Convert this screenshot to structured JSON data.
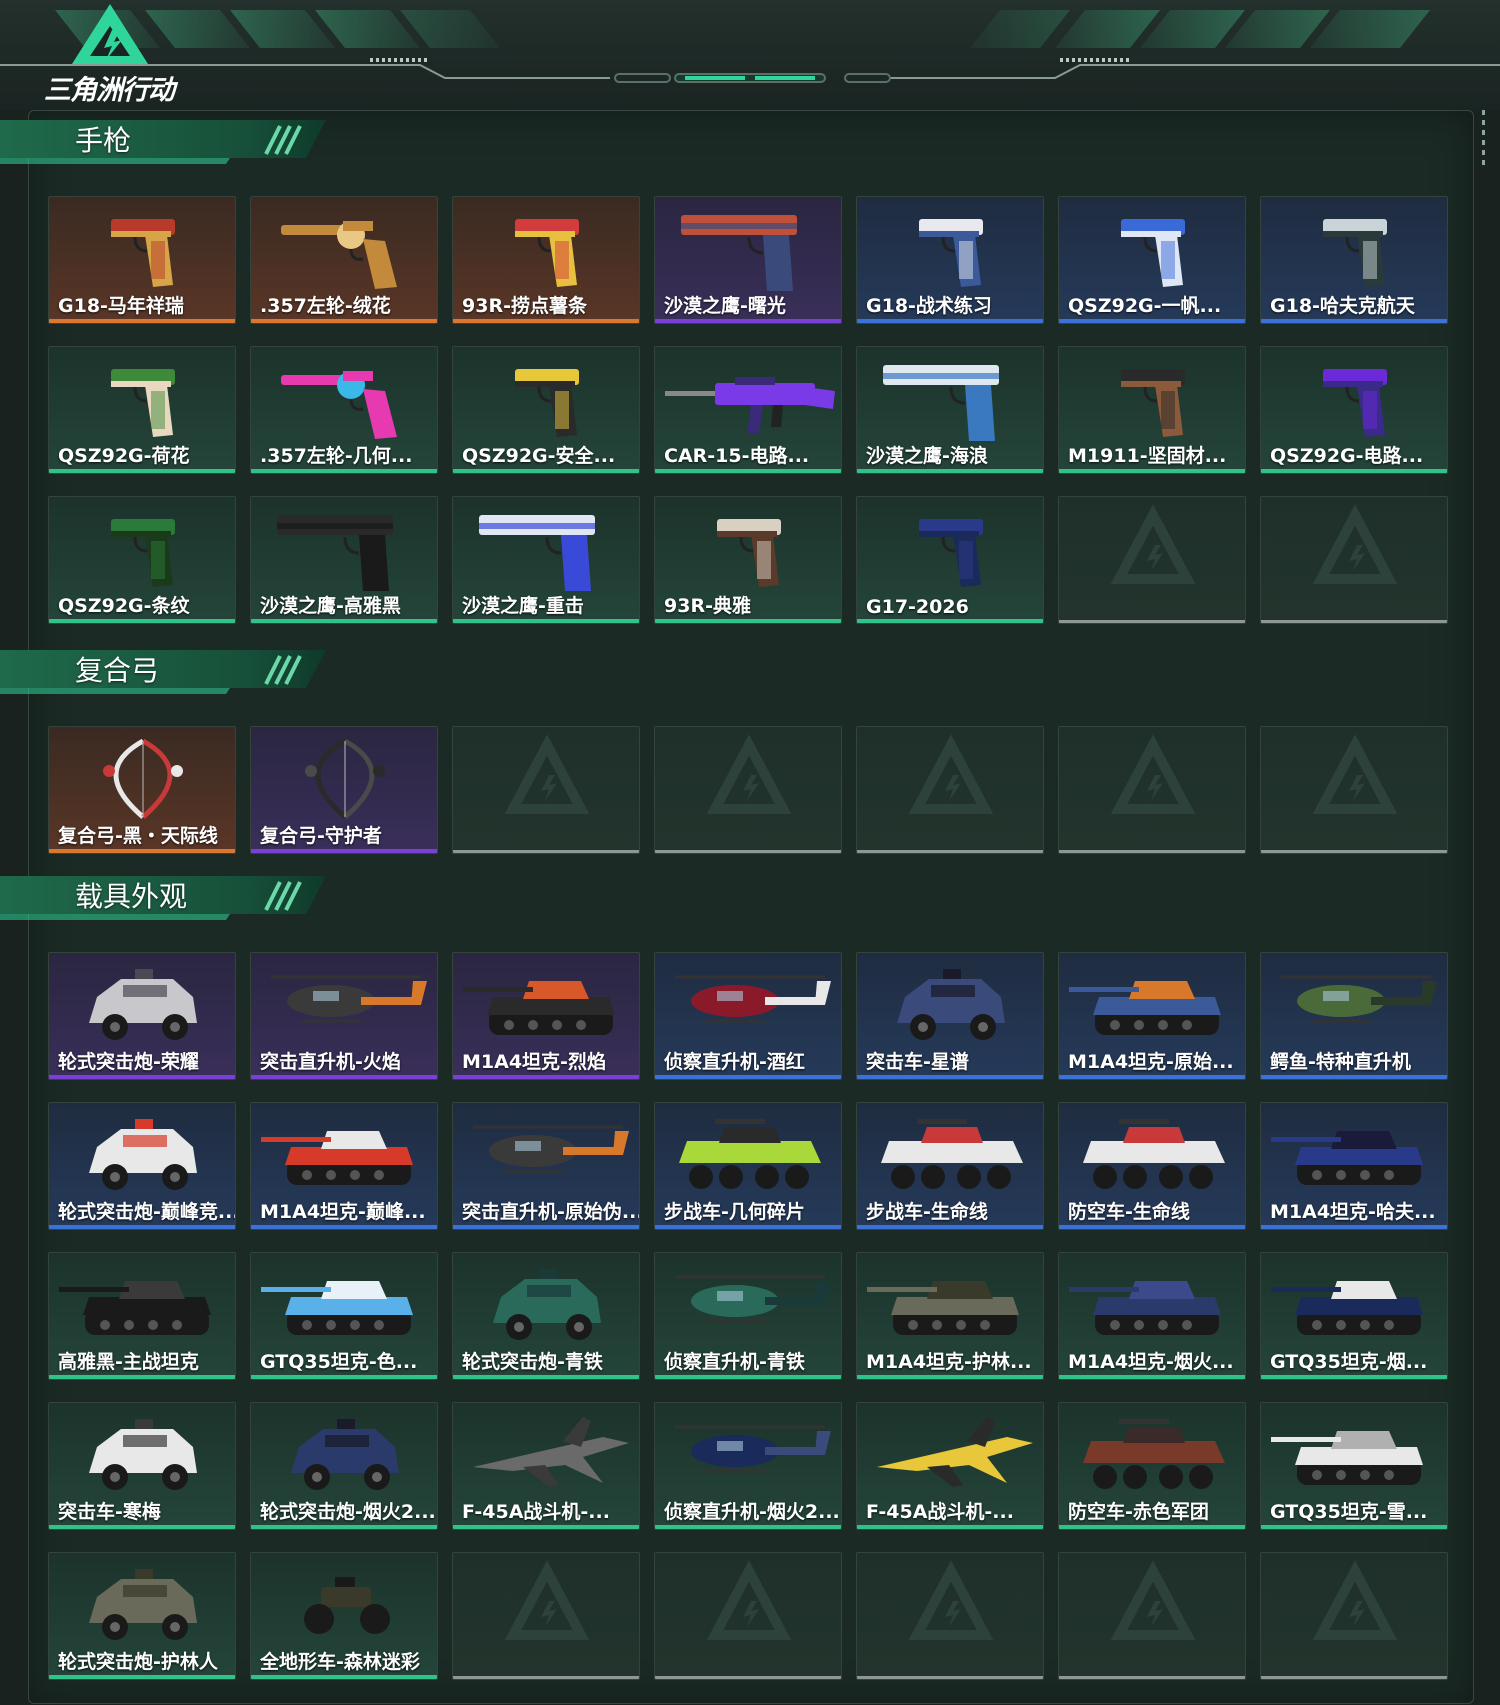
{
  "logo": {
    "text": "三角洲行动"
  },
  "colors": {
    "orange": "#d9782e",
    "purple": "#7a3fd6",
    "blue": "#3a72d8",
    "green": "#2fc38a",
    "empty": "#8d9892",
    "accent": "#2fd59a"
  },
  "sections": [
    {
      "title": "手枪",
      "items": [
        {
          "name": "G18-马年祥瑞",
          "rarity": "orange",
          "icon": "pistol-icon",
          "art": "pistol",
          "tint": [
            "#b83a2a",
            "#d7a447"
          ]
        },
        {
          "name": ".357左轮-绒花",
          "rarity": "orange",
          "icon": "revolver-icon",
          "art": "revolver",
          "tint": [
            "#c28a3a",
            "#e8c884"
          ]
        },
        {
          "name": "93R-捞点薯条",
          "rarity": "orange",
          "icon": "pistol-icon",
          "art": "pistol",
          "tint": [
            "#d23c3c",
            "#e8c040"
          ]
        },
        {
          "name": "沙漠之鹰-曙光",
          "rarity": "purple",
          "icon": "deagle-icon",
          "art": "deagle",
          "tint": [
            "#c0503a",
            "#3a4a7a"
          ]
        },
        {
          "name": "G18-战术练习",
          "rarity": "blue",
          "icon": "pistol-icon",
          "art": "pistol",
          "tint": [
            "#e8e8ee",
            "#3a5a9a"
          ]
        },
        {
          "name": "QSZ92G-一帆...",
          "rarity": "blue",
          "icon": "pistol-icon",
          "art": "pistol",
          "tint": [
            "#3a6ad8",
            "#dfe6f4"
          ]
        },
        {
          "name": "G18-哈夫克航天",
          "rarity": "blue",
          "icon": "pistol-icon",
          "art": "pistol",
          "tint": [
            "#c9d4d8",
            "#2a3a3a"
          ]
        },
        {
          "name": "QSZ92G-荷花",
          "rarity": "green",
          "icon": "pistol-icon",
          "art": "pistol",
          "tint": [
            "#3e8a3a",
            "#e8d8c0"
          ]
        },
        {
          "name": ".357左轮-几何...",
          "rarity": "green",
          "icon": "revolver-icon",
          "art": "revolver",
          "tint": [
            "#e83ab0",
            "#3ab8e8"
          ]
        },
        {
          "name": "QSZ92G-安全...",
          "rarity": "green",
          "icon": "pistol-icon",
          "art": "pistol",
          "tint": [
            "#e8c83a",
            "#2a2a2a"
          ]
        },
        {
          "name": "CAR-15-电路...",
          "rarity": "green",
          "icon": "rifle-icon",
          "art": "rifle",
          "tint": [
            "#7a3ae8",
            "#3a2a7a"
          ]
        },
        {
          "name": "沙漠之鹰-海浪",
          "rarity": "green",
          "icon": "deagle-icon",
          "art": "deagle",
          "tint": [
            "#dfe8f0",
            "#3a78c0"
          ]
        },
        {
          "name": "M1911-坚固材...",
          "rarity": "green",
          "icon": "pistol-icon",
          "art": "pistol",
          "tint": [
            "#2a2a2a",
            "#8a5a3a"
          ]
        },
        {
          "name": "QSZ92G-电路...",
          "rarity": "green",
          "icon": "pistol-icon",
          "art": "pistol",
          "tint": [
            "#6a2ad8",
            "#3a2a8a"
          ]
        },
        {
          "name": "QSZ92G-条纹",
          "rarity": "green",
          "icon": "pistol-icon",
          "art": "pistol",
          "tint": [
            "#2a7a3a",
            "#1a3a1a"
          ]
        },
        {
          "name": "沙漠之鹰-高雅黑",
          "rarity": "green",
          "icon": "deagle-icon",
          "art": "deagle",
          "tint": [
            "#2a2a2a",
            "#1a1a1a"
          ]
        },
        {
          "name": "沙漠之鹰-重击",
          "rarity": "green",
          "icon": "deagle-icon",
          "art": "deagle",
          "tint": [
            "#dfe6f4",
            "#3a4ad8"
          ]
        },
        {
          "name": "93R-典雅",
          "rarity": "green",
          "icon": "pistol-icon",
          "art": "pistol",
          "tint": [
            "#d8d0c0",
            "#5a3a2a"
          ]
        },
        {
          "name": "G17-2026",
          "rarity": "green",
          "icon": "pistol-icon",
          "art": "pistol",
          "tint": [
            "#2a3a8a",
            "#1a2a5a"
          ]
        }
      ],
      "slots": 21
    },
    {
      "title": "复合弓",
      "items": [
        {
          "name": "复合弓-黑・天际线",
          "rarity": "orange",
          "icon": "bow-icon",
          "art": "bow",
          "tint": [
            "#e8e8e8",
            "#c83a3a"
          ]
        },
        {
          "name": "复合弓-守护者",
          "rarity": "purple",
          "icon": "bow-icon",
          "art": "bow",
          "tint": [
            "#2a2a2a",
            "#4a4a4a"
          ]
        }
      ],
      "slots": 7
    },
    {
      "title": "载具外观",
      "items": [
        {
          "name": "轮式突击炮-荣耀",
          "rarity": "purple",
          "icon": "armored-car-icon",
          "art": "car",
          "tint": [
            "#c8c8cc",
            "#4a4a54"
          ]
        },
        {
          "name": "突击直升机-火焰",
          "rarity": "purple",
          "icon": "helicopter-icon",
          "art": "heli",
          "tint": [
            "#3a3a3a",
            "#d8782a"
          ]
        },
        {
          "name": "M1A4坦克-烈焰",
          "rarity": "purple",
          "icon": "tank-icon",
          "art": "tank",
          "tint": [
            "#2a2a2a",
            "#d8582a"
          ]
        },
        {
          "name": "侦察直升机-酒红",
          "rarity": "blue",
          "icon": "helicopter-icon",
          "art": "heli",
          "tint": [
            "#8a1a2a",
            "#e8e8e8"
          ]
        },
        {
          "name": "突击车-星谱",
          "rarity": "blue",
          "icon": "armored-car-icon",
          "art": "car",
          "tint": [
            "#3a4a7a",
            "#1a1a2a"
          ]
        },
        {
          "name": "M1A4坦克-原始...",
          "rarity": "blue",
          "icon": "tank-icon",
          "art": "tank",
          "tint": [
            "#3a5a9a",
            "#d8782a"
          ]
        },
        {
          "name": "鳄鱼-特种直升机",
          "rarity": "blue",
          "icon": "helicopter-icon",
          "art": "heli",
          "tint": [
            "#4a6a3a",
            "#2a3a2a"
          ]
        },
        {
          "name": "轮式突击炮-巅峰竞...",
          "rarity": "blue",
          "icon": "armored-car-icon",
          "art": "car",
          "tint": [
            "#e8e8e8",
            "#d83a2a"
          ]
        },
        {
          "name": "M1A4坦克-巅峰...",
          "rarity": "blue",
          "icon": "tank-icon",
          "art": "tank",
          "tint": [
            "#d83a2a",
            "#e8e8e8"
          ]
        },
        {
          "name": "突击直升机-原始伪...",
          "rarity": "blue",
          "icon": "helicopter-icon",
          "art": "heli",
          "tint": [
            "#3a3a3a",
            "#d8782a"
          ]
        },
        {
          "name": "步战车-几何碎片",
          "rarity": "blue",
          "icon": "ifv-icon",
          "art": "ifv",
          "tint": [
            "#a8d83a",
            "#2a2a2a"
          ]
        },
        {
          "name": "步战车-生命线",
          "rarity": "blue",
          "icon": "ifv-icon",
          "art": "ifv",
          "tint": [
            "#e8e8e8",
            "#c83a3a"
          ]
        },
        {
          "name": "防空车-生命线",
          "rarity": "blue",
          "icon": "ifv-icon",
          "art": "ifv",
          "tint": [
            "#e8e8e8",
            "#c83a3a"
          ]
        },
        {
          "name": "M1A4坦克-哈夫...",
          "rarity": "blue",
          "icon": "tank-icon",
          "art": "tank",
          "tint": [
            "#2a3a8a",
            "#1a1a3a"
          ]
        },
        {
          "name": "高雅黑-主战坦克",
          "rarity": "green",
          "icon": "tank-icon",
          "art": "tank",
          "tint": [
            "#1a1a1a",
            "#3a3a3a"
          ]
        },
        {
          "name": "GTQ35坦克-色...",
          "rarity": "green",
          "icon": "tank-icon",
          "art": "tank",
          "tint": [
            "#5ab0e8",
            "#e8f0f8"
          ]
        },
        {
          "name": "轮式突击炮-青铁",
          "rarity": "green",
          "icon": "armored-car-icon",
          "art": "car",
          "tint": [
            "#2a6a5a",
            "#1a3a3a"
          ]
        },
        {
          "name": "侦察直升机-青铁",
          "rarity": "green",
          "icon": "helicopter-icon",
          "art": "heli",
          "tint": [
            "#2a6a5a",
            "#1a3a3a"
          ]
        },
        {
          "name": "M1A4坦克-护林...",
          "rarity": "green",
          "icon": "tank-icon",
          "art": "tank",
          "tint": [
            "#6a6a5a",
            "#3a3a2a"
          ]
        },
        {
          "name": "M1A4坦克-烟火...",
          "rarity": "green",
          "icon": "tank-icon",
          "art": "tank",
          "tint": [
            "#2a3a6a",
            "#3a4a8a"
          ]
        },
        {
          "name": "GTQ35坦克-烟...",
          "rarity": "green",
          "icon": "tank-icon",
          "art": "tank",
          "tint": [
            "#1a2a5a",
            "#e8e8e8"
          ]
        },
        {
          "name": "突击车-寒梅",
          "rarity": "green",
          "icon": "armored-car-icon",
          "art": "car",
          "tint": [
            "#e8e8e8",
            "#3a3a3a"
          ]
        },
        {
          "name": "轮式突击炮-烟火2...",
          "rarity": "green",
          "icon": "armored-car-icon",
          "art": "car",
          "tint": [
            "#2a3a6a",
            "#1a1a2a"
          ]
        },
        {
          "name": "F-45A战斗机-...",
          "rarity": "green",
          "icon": "jet-icon",
          "art": "jet",
          "tint": [
            "#6a6a6a",
            "#3a3a3a"
          ]
        },
        {
          "name": "侦察直升机-烟火2...",
          "rarity": "green",
          "icon": "helicopter-icon",
          "art": "heli",
          "tint": [
            "#1a2a5a",
            "#3a4a7a"
          ]
        },
        {
          "name": "F-45A战斗机-...",
          "rarity": "green",
          "icon": "jet-icon",
          "art": "jet",
          "tint": [
            "#e8c83a",
            "#2a2a2a"
          ]
        },
        {
          "name": "防空车-赤色军团",
          "rarity": "green",
          "icon": "ifv-icon",
          "art": "ifv",
          "tint": [
            "#7a3a2a",
            "#3a2a2a"
          ]
        },
        {
          "name": "GTQ35坦克-雪...",
          "rarity": "green",
          "icon": "tank-icon",
          "art": "tank",
          "tint": [
            "#e8e8e8",
            "#b0b0b0"
          ]
        },
        {
          "name": "轮式突击炮-护林人",
          "rarity": "green",
          "icon": "armored-car-icon",
          "art": "car",
          "tint": [
            "#6a6a5a",
            "#3a3a2a"
          ]
        },
        {
          "name": "全地形车-森林迷彩",
          "rarity": "green",
          "icon": "atv-icon",
          "art": "atv",
          "tint": [
            "#3a3a2a",
            "#1a1a1a"
          ]
        }
      ],
      "slots": 35
    }
  ]
}
